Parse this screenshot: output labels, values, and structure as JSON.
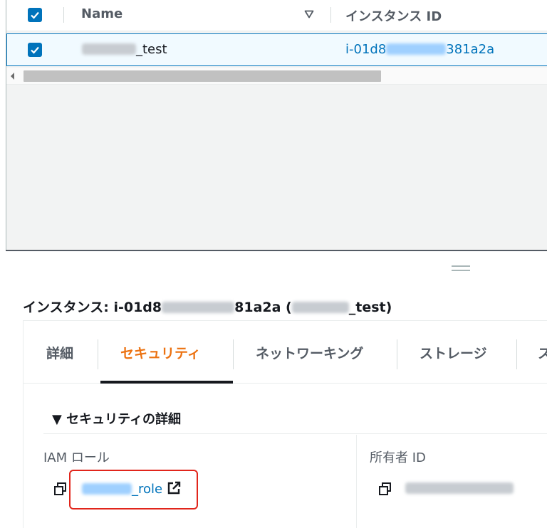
{
  "table": {
    "columns": {
      "name": "Name",
      "instance_id": "インスタンス ID"
    },
    "row": {
      "name_suffix": "_test",
      "instance_id_prefix": "i-01d8",
      "instance_id_suffix": "381a2a"
    }
  },
  "details": {
    "title_prefix": "インスタンス: i-01d8",
    "title_mid": "81a2a (",
    "title_suffix": "_test)",
    "tabs": [
      "詳細",
      "セキュリティ",
      "ネットワーキング",
      "ストレージ",
      "ス"
    ],
    "active_tab": "セキュリティ",
    "section_title": "▼ セキュリティの詳細",
    "iam_role_label": "IAM ロール",
    "iam_role_suffix": "_role",
    "owner_id_label": "所有者 ID"
  },
  "colors": {
    "accent_orange": "#ec7211",
    "link_blue": "#0073bb",
    "selected_row_bg": "#f1faff",
    "highlight_red": "#e1251b"
  },
  "icons": [
    "checkbox-checked-icon",
    "sort-down-icon",
    "scroll-left-icon",
    "drag-handle-icon",
    "copy-icon",
    "external-link-icon"
  ]
}
